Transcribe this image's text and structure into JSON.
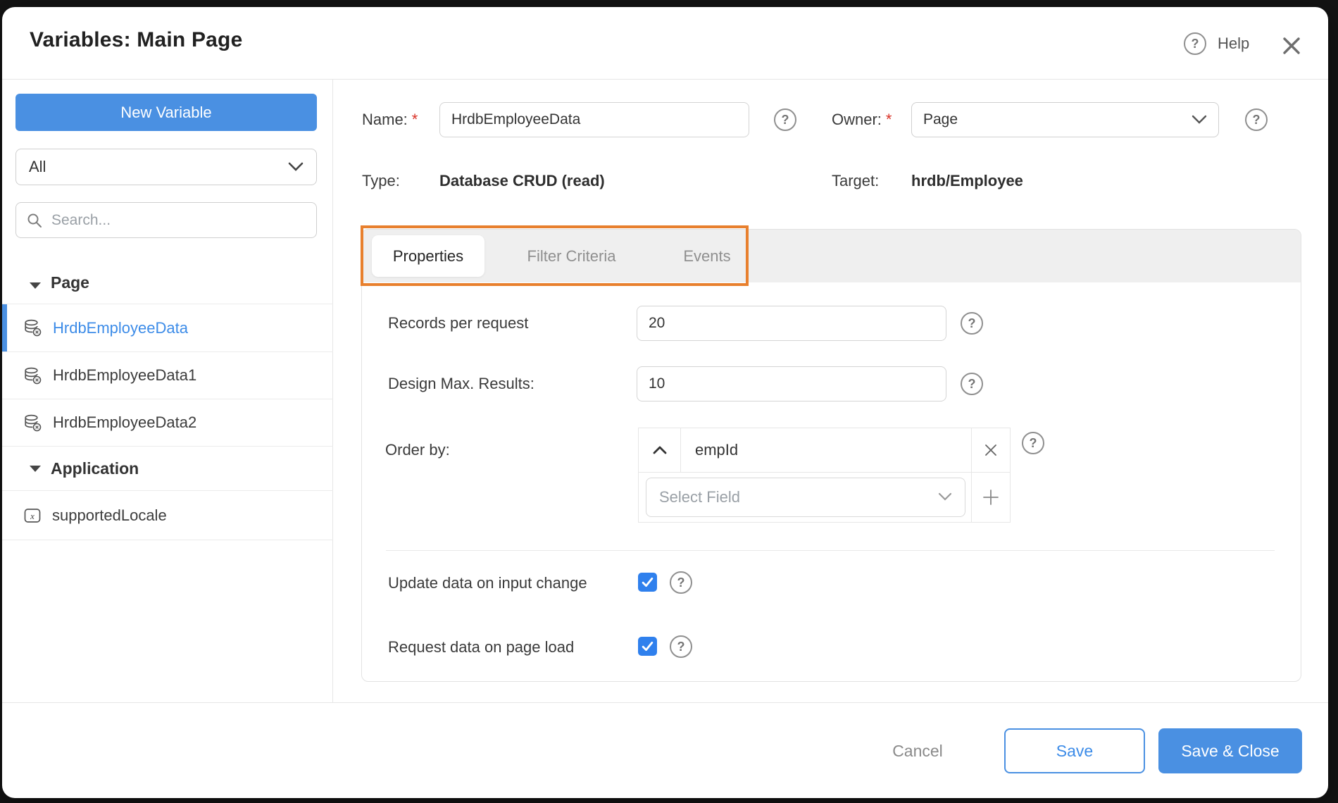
{
  "window": {
    "title": "Variables: Main Page",
    "help_label": "Help"
  },
  "sidebar": {
    "new_variable_label": "New Variable",
    "filter_dropdown_value": "All",
    "search_placeholder": "Search...",
    "sections": [
      {
        "label": "Page",
        "items": [
          {
            "label": "HrdbEmployeeData",
            "selected": true,
            "icon": "database-crud-variable-icon"
          },
          {
            "label": "HrdbEmployeeData1",
            "selected": false,
            "icon": "database-crud-variable-icon"
          },
          {
            "label": "HrdbEmployeeData2",
            "selected": false,
            "icon": "database-crud-variable-icon"
          }
        ]
      },
      {
        "label": "Application",
        "items": [
          {
            "label": "supportedLocale",
            "selected": false,
            "icon": "static-variable-icon"
          }
        ]
      }
    ]
  },
  "form": {
    "required_marker": "*",
    "name": {
      "label": "Name:",
      "required": true,
      "value": "HrdbEmployeeData"
    },
    "owner": {
      "label": "Owner:",
      "required": true,
      "value": "Page"
    },
    "type": {
      "label": "Type:",
      "value": "Database CRUD (read)"
    },
    "target": {
      "label": "Target:",
      "value": "hrdb/Employee"
    }
  },
  "tabs": [
    {
      "label": "Properties",
      "active": true
    },
    {
      "label": "Filter Criteria",
      "active": false
    },
    {
      "label": "Events",
      "active": false
    }
  ],
  "properties_tab": {
    "records_per_request": {
      "label": "Records per request",
      "value": "20"
    },
    "design_max_results": {
      "label": "Design Max. Results:",
      "value": "10"
    },
    "order_by": {
      "label": "Order by:",
      "sort_field": "empId",
      "sort_direction": "ascending",
      "select_placeholder": "Select Field"
    },
    "update_data_on_input_change": {
      "label": "Update data on input change",
      "checked": true
    },
    "request_data_on_page_load": {
      "label": "Request data on page load",
      "checked": true
    }
  },
  "footer": {
    "cancel_label": "Cancel",
    "save_label": "Save",
    "save_close_label": "Save & Close"
  },
  "colors": {
    "accent_blue": "#4A90E2",
    "selected_text_blue": "#3D8CE8",
    "checkbox_blue": "#2F80ED",
    "annotation_orange": "#E8802E",
    "tab_strip_gray": "#EFEFEF"
  },
  "icons": {
    "help": "question-mark-circle",
    "close": "x-mark",
    "search": "magnifier",
    "sort_direction": "chevron-up",
    "remove_field": "x-mark",
    "add_field": "plus"
  }
}
